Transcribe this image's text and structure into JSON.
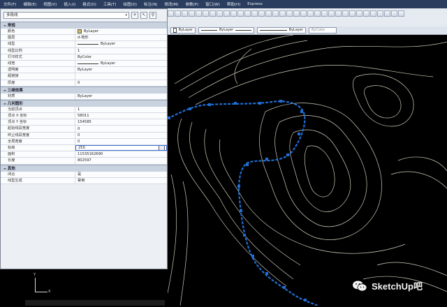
{
  "menubar": {
    "items": [
      "文件(F)",
      "编辑(E)",
      "视图(V)",
      "插入(I)",
      "格式(O)",
      "工具(T)",
      "绘图(D)",
      "标注(N)",
      "修改(M)",
      "参数(P)",
      "窗口(W)",
      "帮助(H)",
      "Express"
    ]
  },
  "toolbar2": {
    "layer_combo": "ByLayer",
    "linetype_combo": "ByLayer",
    "lineweight_combo": "ByLayer",
    "plotstyle_combo": "ByColor"
  },
  "panel": {
    "object_type": "多段线",
    "sections": [
      {
        "title": "常规",
        "rows": [
          {
            "key": "颜色",
            "value": "ByLayer",
            "swatch": "#d9c06a"
          },
          {
            "key": "图层",
            "value": "d-地形"
          },
          {
            "key": "线型",
            "value": "ByLayer",
            "line": true
          },
          {
            "key": "线型比例",
            "value": "1"
          },
          {
            "key": "打印样式",
            "value": "ByColor"
          },
          {
            "key": "线宽",
            "value": "ByLayer",
            "line": true
          },
          {
            "key": "透明度",
            "value": "ByLayer"
          },
          {
            "key": "超链接",
            "value": ""
          },
          {
            "key": "厚度",
            "value": "0"
          }
        ]
      },
      {
        "title": "三维效果",
        "rows": [
          {
            "key": "材质",
            "value": "ByLayer"
          }
        ]
      },
      {
        "title": "几何图形",
        "rows": [
          {
            "key": "当前顶点",
            "value": "1"
          },
          {
            "key": "顶点 X 坐标",
            "value": "58011"
          },
          {
            "key": "顶点 Y 坐标",
            "value": "154585"
          },
          {
            "key": "起始线段宽度",
            "value": "0"
          },
          {
            "key": "终止线段宽度",
            "value": "0"
          },
          {
            "key": "全局宽度",
            "value": "0"
          },
          {
            "key": "标高",
            "value": "250",
            "highlight": true
          },
          {
            "key": "面积",
            "value": "11535162690"
          },
          {
            "key": "长度",
            "value": "802597"
          }
        ]
      },
      {
        "title": "其他",
        "rows": [
          {
            "key": "闭合",
            "value": "是"
          },
          {
            "key": "线型生成",
            "value": "禁用"
          }
        ]
      }
    ]
  },
  "ucs": {
    "x_label": "X",
    "y_label": "Y"
  },
  "watermark": {
    "text": "SketchUp吧"
  },
  "colors": {
    "menubar": "#2b3d5e",
    "contour": "#e9e4cf",
    "selected_polyline": "#1f6fd6",
    "canvas": "#000000"
  }
}
